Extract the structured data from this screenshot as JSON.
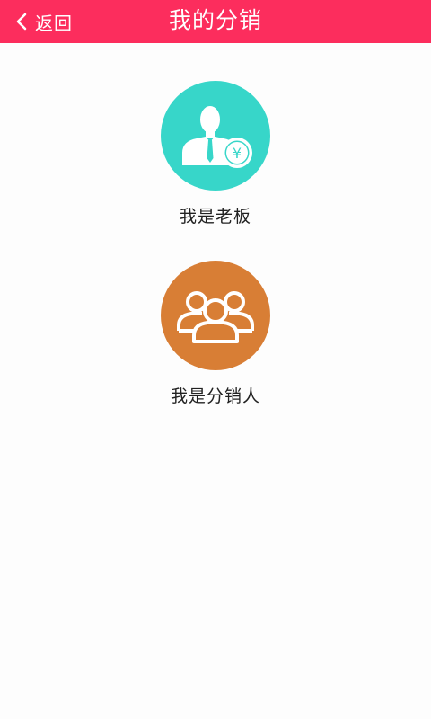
{
  "header": {
    "title": "我的分销",
    "back_label": "返回",
    "background": "#fc2d5d",
    "icon": "chevron-left-icon"
  },
  "roles": [
    {
      "label": "我是老板",
      "icon": "businessman-yuan-icon",
      "color": "#37d6c9"
    },
    {
      "label": "我是分销人",
      "icon": "group-people-icon",
      "color": "#d87e35"
    }
  ]
}
